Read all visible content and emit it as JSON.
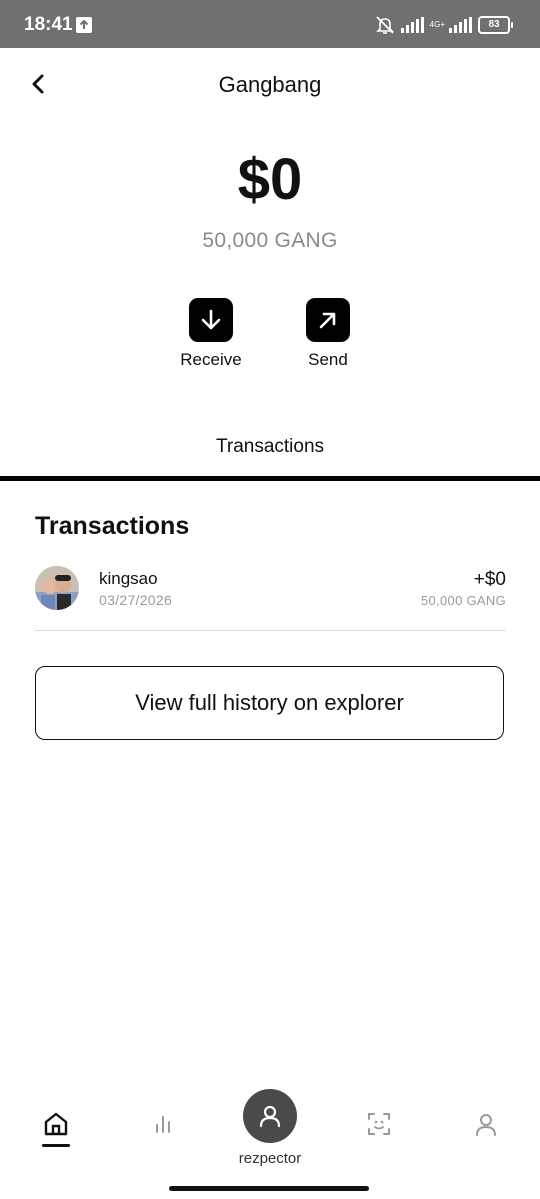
{
  "status_bar": {
    "time": "18:41",
    "network_label": "4G+",
    "battery": "83",
    "icons": [
      "upload-icon",
      "bell-off-icon",
      "signal-icon",
      "battery-icon"
    ]
  },
  "header": {
    "title": "Gangbang",
    "back_icon": "chevron-left-icon"
  },
  "balance": {
    "fiat": "$0",
    "token": "50,000 GANG"
  },
  "actions": [
    {
      "label": "Receive",
      "icon": "arrow-down-icon"
    },
    {
      "label": "Send",
      "icon": "arrow-up-right-icon"
    }
  ],
  "tabs": {
    "active": "Transactions"
  },
  "transactions": {
    "title": "Transactions",
    "items": [
      {
        "name": "kingsao",
        "date": "03/27/2026",
        "amount": "+$0",
        "token_amount": "50,000 GANG"
      }
    ],
    "explorer_button": "View full history on explorer"
  },
  "bottom_nav": {
    "items": [
      "home-icon",
      "chart-icon",
      "profile-icon",
      "scan-icon",
      "user-icon"
    ],
    "center_label": "rezpector"
  },
  "colors": {
    "status_bar": "#707070",
    "accent": "#000000",
    "muted_text": "#8a8a8a"
  }
}
